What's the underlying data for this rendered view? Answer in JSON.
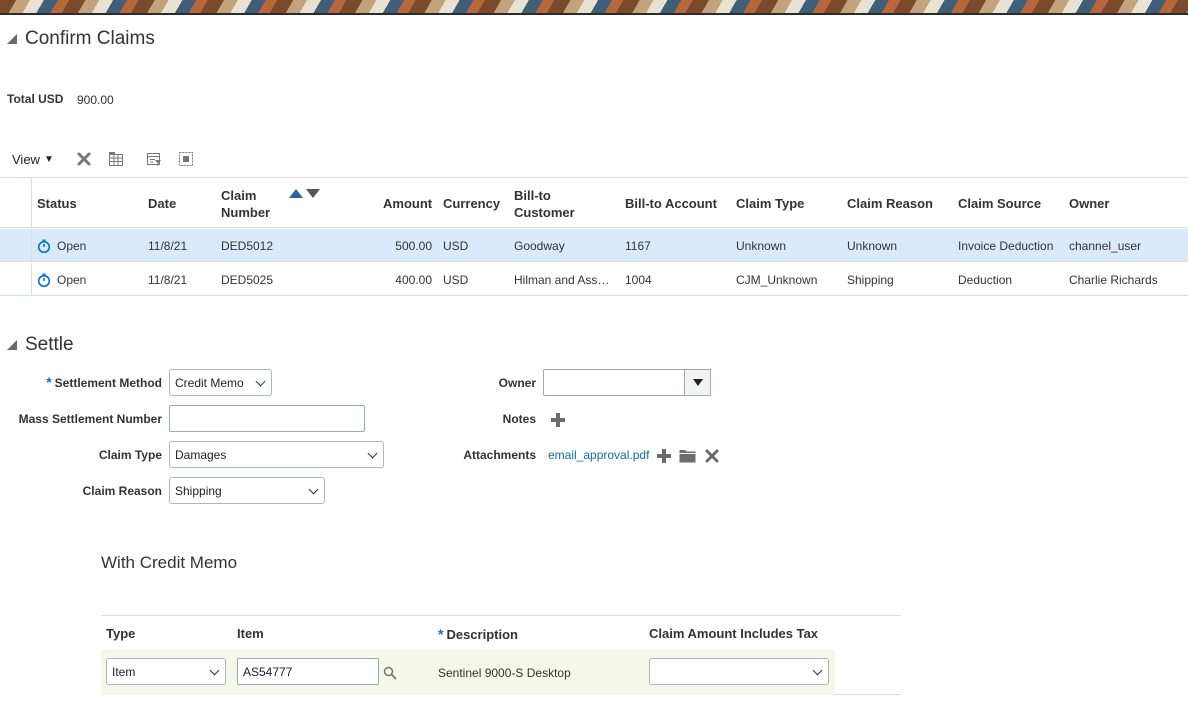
{
  "confirm": {
    "title": "Confirm Claims",
    "total_label": "Total USD",
    "total_value": "900.00"
  },
  "toolbar": {
    "view_label": "View",
    "icons": [
      "delete-icon",
      "freeze-icon",
      "filter-icon",
      "detach-icon"
    ]
  },
  "claims_table": {
    "headers": {
      "status": "Status",
      "date": "Date",
      "claim_number": "Claim Number",
      "amount": "Amount",
      "currency": "Currency",
      "bill_to_customer": "Bill-to Customer",
      "bill_to_account": "Bill-to Account",
      "claim_type": "Claim Type",
      "claim_reason": "Claim Reason",
      "claim_source": "Claim Source",
      "owner": "Owner"
    },
    "rows": [
      {
        "status": "Open",
        "date": "11/8/21",
        "claim_number": "DED5012",
        "amount": "500.00",
        "currency": "USD",
        "bill_to_customer": "Goodway",
        "bill_to_account": "1167",
        "claim_type": "Unknown",
        "claim_reason": "Unknown",
        "claim_source": "Invoice Deduction",
        "owner": "channel_user"
      },
      {
        "status": "Open",
        "date": "11/8/21",
        "claim_number": "DED5025",
        "amount": "400.00",
        "currency": "USD",
        "bill_to_customer": "Hilman and Ass…",
        "bill_to_account": "1004",
        "claim_type": "CJM_Unknown",
        "claim_reason": "Shipping",
        "claim_source": "Deduction",
        "owner": "Charlie Richards"
      }
    ]
  },
  "settle": {
    "title": "Settle",
    "required_marker": "*",
    "settlement_method_label": "Settlement Method",
    "settlement_method_value": "Credit Memo",
    "mass_settlement_label": "Mass Settlement Number",
    "mass_settlement_value": "",
    "claim_type_label": "Claim Type",
    "claim_type_value": "Damages",
    "claim_reason_label": "Claim Reason",
    "claim_reason_value": "Shipping",
    "owner_label": "Owner",
    "owner_value": "",
    "notes_label": "Notes",
    "attachments_label": "Attachments",
    "attachment_file": "email_approval.pdf"
  },
  "credit_memo": {
    "title": "With Credit Memo",
    "headers": {
      "type": "Type",
      "item": "Item",
      "description": "Description",
      "tax": "Claim Amount Includes Tax"
    },
    "row": {
      "type": "Item",
      "item": "AS54777",
      "description": "Sentinel 9000-S Desktop",
      "tax": ""
    }
  },
  "colors": {
    "accent": "#0572ce",
    "selected_row": "#dbeafa",
    "link": "#0f6ea8",
    "memo_row": "#f5f7e9"
  }
}
